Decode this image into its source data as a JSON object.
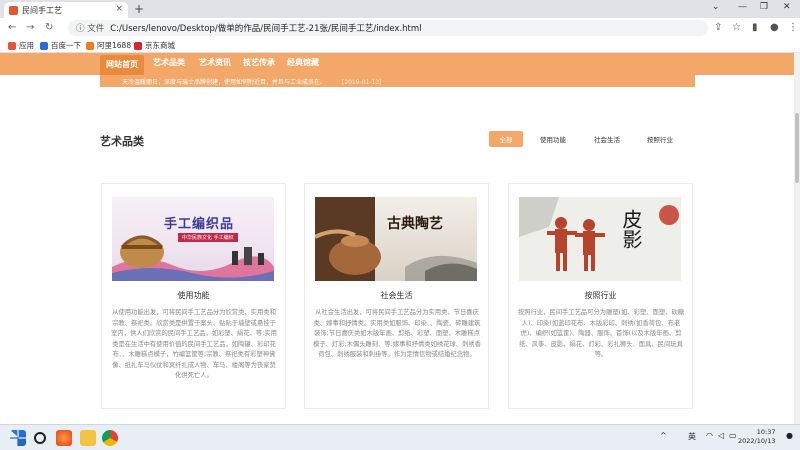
{
  "browser": {
    "tab_title": "民间手工艺",
    "tab_close": "×",
    "new_tab": "+",
    "win_min": "—",
    "win_max": "❐",
    "win_close": "✕",
    "back": "←",
    "forward": "→",
    "reload": "↻",
    "secure_label": "ⓘ 文件",
    "url": "C:/Users/lenovo/Desktop/做单的作品/民间手工艺-21张/民间手工艺/index.html",
    "share": "⇪",
    "star": "☆",
    "sidebar": "▮",
    "profile": "●",
    "menu": "⋮",
    "bookmarks": [
      {
        "label": "应用",
        "color": "#e5533c"
      },
      {
        "label": "百度一下",
        "color": "#2b6bd9"
      },
      {
        "label": "阿里1688",
        "color": "#f47a20"
      },
      {
        "label": "京东商城",
        "color": "#d9232e"
      }
    ]
  },
  "site": {
    "nav": [
      {
        "label": "网站首页",
        "active": true
      },
      {
        "label": "艺术品类",
        "active": false
      },
      {
        "label": "艺术资讯",
        "active": false
      },
      {
        "label": "技艺传承",
        "active": false
      },
      {
        "label": "经典馆藏",
        "active": false
      }
    ],
    "ticker_text": "天冷温暖丽日，深度与瑞士品牌创建，使用如何附近目，并且与工业成员在。",
    "ticker_date": "[2019-01-13]",
    "section_title": "艺术品类",
    "filters": [
      {
        "label": "全部",
        "active": true
      },
      {
        "label": "使用功能",
        "active": false
      },
      {
        "label": "社会生活",
        "active": false
      },
      {
        "label": "按照行业",
        "active": false
      }
    ],
    "cards": [
      {
        "image_text": "手工编织品",
        "image_sub": "中华民族文化 手工编织",
        "title": "使用功能",
        "desc": "从使用功能出发，可将民间手工艺品分为欣赏类、实用类和宗教、祭祀类。欣赏类是供置于案头、贴贴于墙壁或悬挂于室内，供人们欣赏的民间手工艺品，如彩塑、绢花、等;实用类是在生活中有使用价值的民间手工艺品，如陶罐、彩印花布、、木雕糕点模子，竹编篮筐等;宗教、祭祀类有彩塑神佛像、纸扎车马仪仗和冥纤扎成人物、车马、楼阁等为丧家焚化供死亡人。"
      },
      {
        "image_text": "古典陶艺",
        "title": "社会生活",
        "desc": "从社会生活出发，可将民间手工艺品分为实用类、节日喜庆类、嫁事和抒情类。实用类如服饰、印染、、陶瓷、砖雕建筑装饰;节日喜庆类如木版年画、剪纸、彩塑、面塑、木雕糕点模子、灯彩;木偶头雕刻、等;嫁事和抒情类如绣花球、刺绣香荷包、刺绣服装和刺褂等。作为定情信物或结婚纪念物。"
      },
      {
        "image_text": "皮影",
        "title": "按照行业",
        "desc": "按照行业，民间手工艺品可分为雕塑(如、彩塑、面塑、砍糖人)、印染(如蓝印花布、木版彩印、刺绣(如香荷包、布老虎)、编织(如篮筐)、陶器、服饰、首饰(以及木版年画、剪纸、风筝、皮影、绢花、灯彩、彩扎狮头、面具、民间玩具等。"
      }
    ]
  },
  "taskbar": {
    "ime": "英",
    "time": "10:37",
    "date": "2022/10/13",
    "tray_up": "^"
  }
}
